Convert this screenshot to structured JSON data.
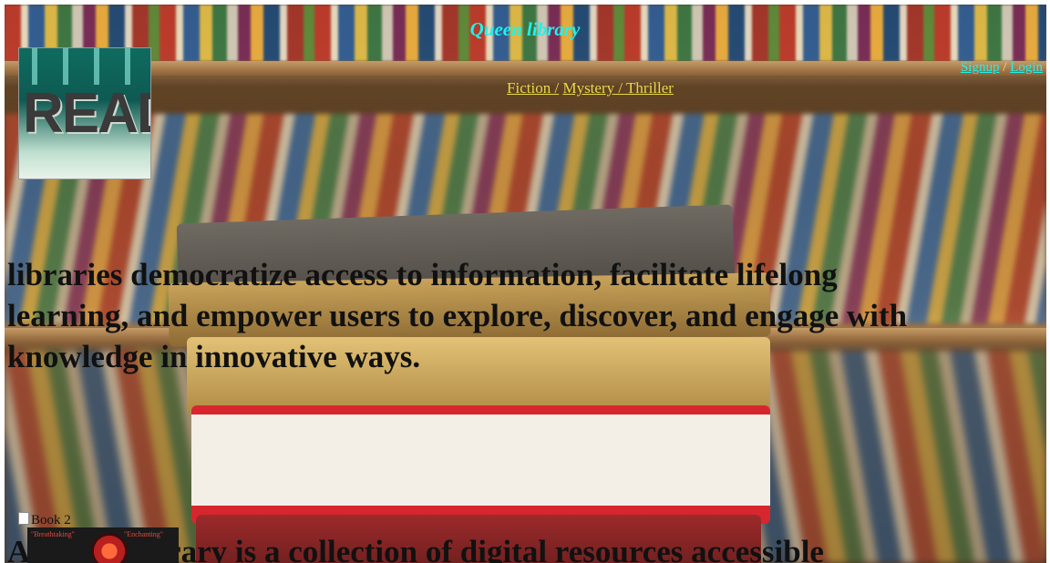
{
  "header": {
    "title": "Queen library",
    "auth": {
      "signup_label": "Signup",
      "separator": "/",
      "login_label": "Login"
    }
  },
  "nav": {
    "items": [
      {
        "label": "Fiction /"
      },
      {
        "label": "Mystery / Thriller"
      }
    ]
  },
  "logo": {
    "text": "READ"
  },
  "main": {
    "hero_text": "libraries democratize access to information, facilitate lifelong learning, and empower users to explore, discover, and engage with knowledge in innovative ways.",
    "book_image_alt": "Book 2",
    "thumbnail": {
      "quote_left": "\"Breathtaking\"",
      "quote_right": "\"Enchanting\""
    },
    "second_heading": "A digital library is a collection of digital resources accessible"
  },
  "colors": {
    "title": "#19f5f0",
    "nav_link": "#e8d94a",
    "text": "#111111"
  }
}
